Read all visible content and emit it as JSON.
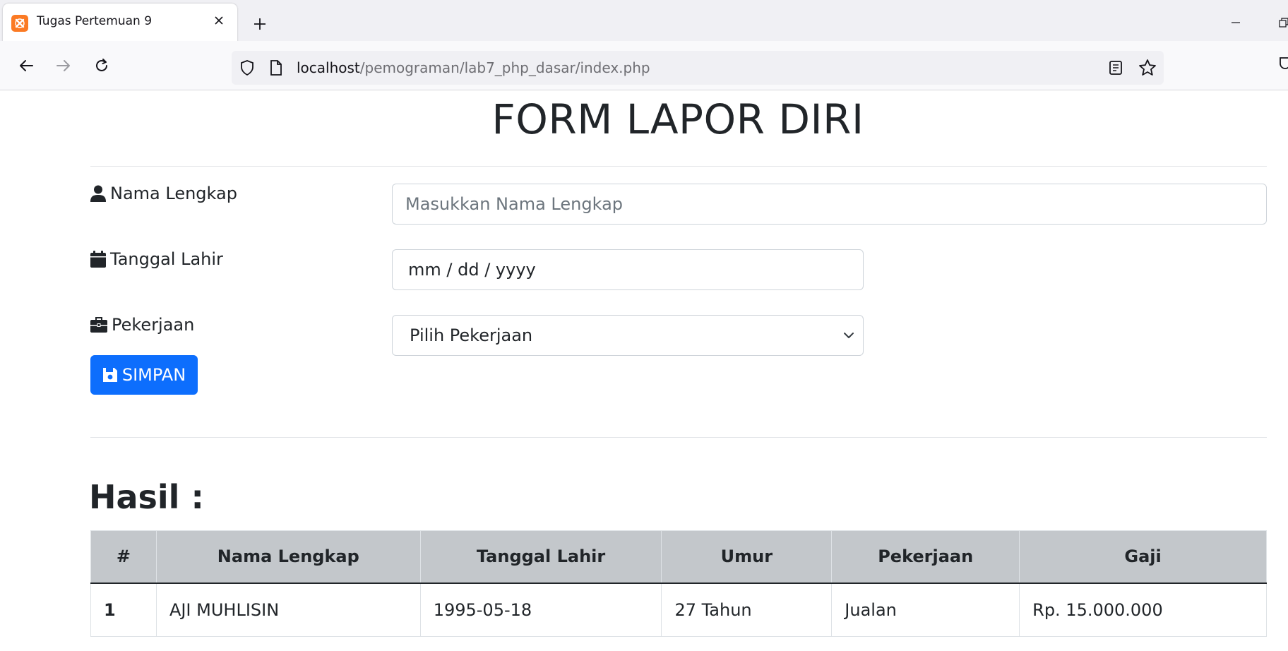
{
  "browser": {
    "tab_title": "Tugas Pertemuan 9",
    "url_host": "localhost",
    "url_path": "/pemograman/lab7_php_dasar/index.php"
  },
  "page": {
    "title": "FORM LAPOR DIRI",
    "form": {
      "nama_label": "Nama Lengkap",
      "nama_placeholder": "Masukkan Nama Lengkap",
      "tanggal_label": "Tanggal Lahir",
      "tanggal_value": "mm / dd / yyyy",
      "pekerjaan_label": "Pekerjaan",
      "pekerjaan_selected": "Pilih Pekerjaan",
      "submit_label": "SIMPAN"
    },
    "result": {
      "title": "Hasil :",
      "columns": [
        "#",
        "Nama Lengkap",
        "Tanggal Lahir",
        "Umur",
        "Pekerjaan",
        "Gaji"
      ],
      "rows": [
        {
          "no": "1",
          "nama": "AJI MUHLISIN",
          "tanggal_lahir": "1995-05-18",
          "umur": "27 Tahun",
          "pekerjaan": "Jualan",
          "gaji": "Rp. 15.000.000"
        }
      ]
    }
  },
  "colors": {
    "primary_button": "#0d6efd",
    "table_header": "#c3c7cb",
    "favicon": "#fb7a24"
  }
}
